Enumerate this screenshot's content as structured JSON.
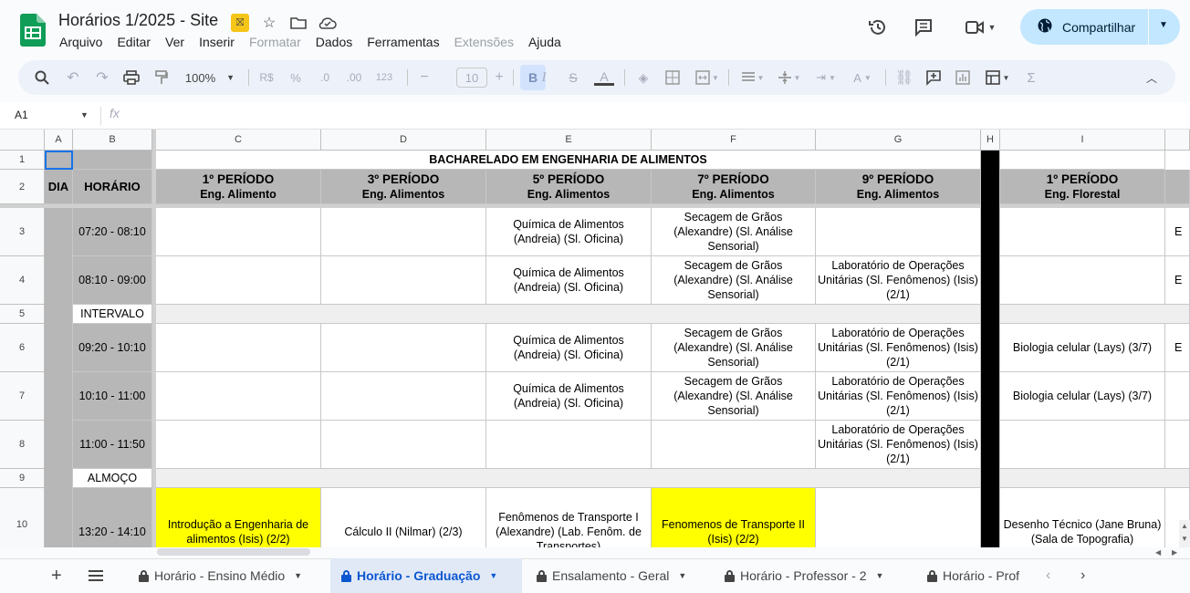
{
  "app": {
    "title": "Horários 1/2025 - Site",
    "share_label": "Compartilhar"
  },
  "menu": [
    "Arquivo",
    "Editar",
    "Ver",
    "Inserir",
    "Formatar",
    "Dados",
    "Ferramentas",
    "Extensões",
    "Ajuda"
  ],
  "toolbar": {
    "zoom": "100%",
    "currency": "R$",
    "percent": "%",
    "dec_less": ".0",
    "dec_more": ".00",
    "format123": "123",
    "font_size": "10",
    "bold": "B",
    "italic": "I"
  },
  "formula": {
    "cell_ref": "A1",
    "fx": "fx"
  },
  "columns": [
    "A",
    "B",
    "C",
    "D",
    "E",
    "F",
    "G",
    "H",
    "I"
  ],
  "rows": [
    "1",
    "2",
    "3",
    "4",
    "5",
    "6",
    "7",
    "8",
    "9",
    "10"
  ],
  "sheet": {
    "banner": "BACHARELADO EM ENGENHARIA DE ALIMENTOS",
    "dia": "DIA",
    "horario": "HORÁRIO",
    "periods": [
      {
        "p": "1º PERÍODO",
        "c": "Eng. Alimento"
      },
      {
        "p": "3º PERÍODO",
        "c": "Eng. Alimentos"
      },
      {
        "p": "5º PERÍODO",
        "c": "Eng. Alimentos"
      },
      {
        "p": "7º PERÍODO",
        "c": "Eng. Alimentos"
      },
      {
        "p": "9º PERÍODO",
        "c": "Eng. Alimentos"
      },
      {
        "p": "1º PERÍODO",
        "c": "Eng. Florestal"
      }
    ],
    "times": [
      "07:20 - 08:10",
      "08:10 - 09:00",
      "INTERVALO",
      "09:20 - 10:10",
      "10:10 - 11:00",
      "11:00 - 11:50",
      "ALMOÇO",
      "13:20 - 14:10"
    ],
    "quimica": "Química de Alimentos (Andreia) (Sl. Oficina)",
    "secagem": "Secagem de Grãos (Alexandre)  (Sl. Análise Sensorial)",
    "lab": "Laboratório de Operações Unitárias (Sl. Fenômenos) (Isis) (2/1)",
    "lab6": "Laboratório de Operações Unitárias (Sl. Fenômenos) (Isis)(2/1)",
    "lab7": "Laboratório de Operações Unitárias (Sl. Fenômenos) (Isis)  (2/1)",
    "biologia": "Biologia celular (Lays) (3/7)",
    "intro": "Introdução a Engenharia de alimentos (Isis) (2/2)",
    "calculo": "Cálculo II (Nilmar) (2/3)",
    "fenomenos1": "Fenômenos de Transporte I (Alexandre)  (Lab. Fenôm. de Transportes)",
    "fenomenos2": "Fenomenos de Transporte II (Isis) (2/2)",
    "desenho": "Desenho Técnico (Jane Bruna) (Sala de Topografia)",
    "edge_text": "E"
  },
  "tabs": [
    "Horário - Ensino Médio",
    "Horário - Graduação",
    "Ensalamento - Geral",
    "Horário - Professor - 2",
    "Horário - Prof"
  ],
  "colors": {
    "yellow": "#ffff00",
    "gray": "#b7b7b7",
    "share_bg": "#c2e7ff",
    "accent": "#0b57d0"
  }
}
